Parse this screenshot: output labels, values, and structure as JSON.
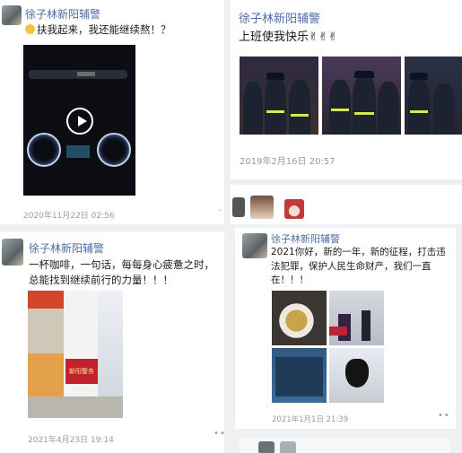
{
  "posts": [
    {
      "user": "徐子林新阳辅警",
      "text": "扶我起来，我还能继续熬！？",
      "timestamp": "2020年11月22日 02:56"
    },
    {
      "user": "徐子林新阳辅警",
      "text": "上班使我快乐✌✌✌",
      "timestamp": "2019年2月16日 20:57"
    },
    {
      "user": "徐子林新阳辅警",
      "text": "一杯咖啡，一句话，每每身心疲惫之时，总能找到继续前行的力量！！！",
      "timestamp": "2021年4月23日 19:14",
      "sign_text": "新阳警务"
    },
    {
      "user": "徐子林新阳辅警",
      "text": "2021你好，新的一年，新的征程，打击违法犯罪，保护人民生命财产，我们一直在！！！",
      "timestamp": "2021年1月1日 21:39"
    }
  ],
  "icons": {
    "more": "more-dots-icon",
    "play": "play-icon"
  }
}
